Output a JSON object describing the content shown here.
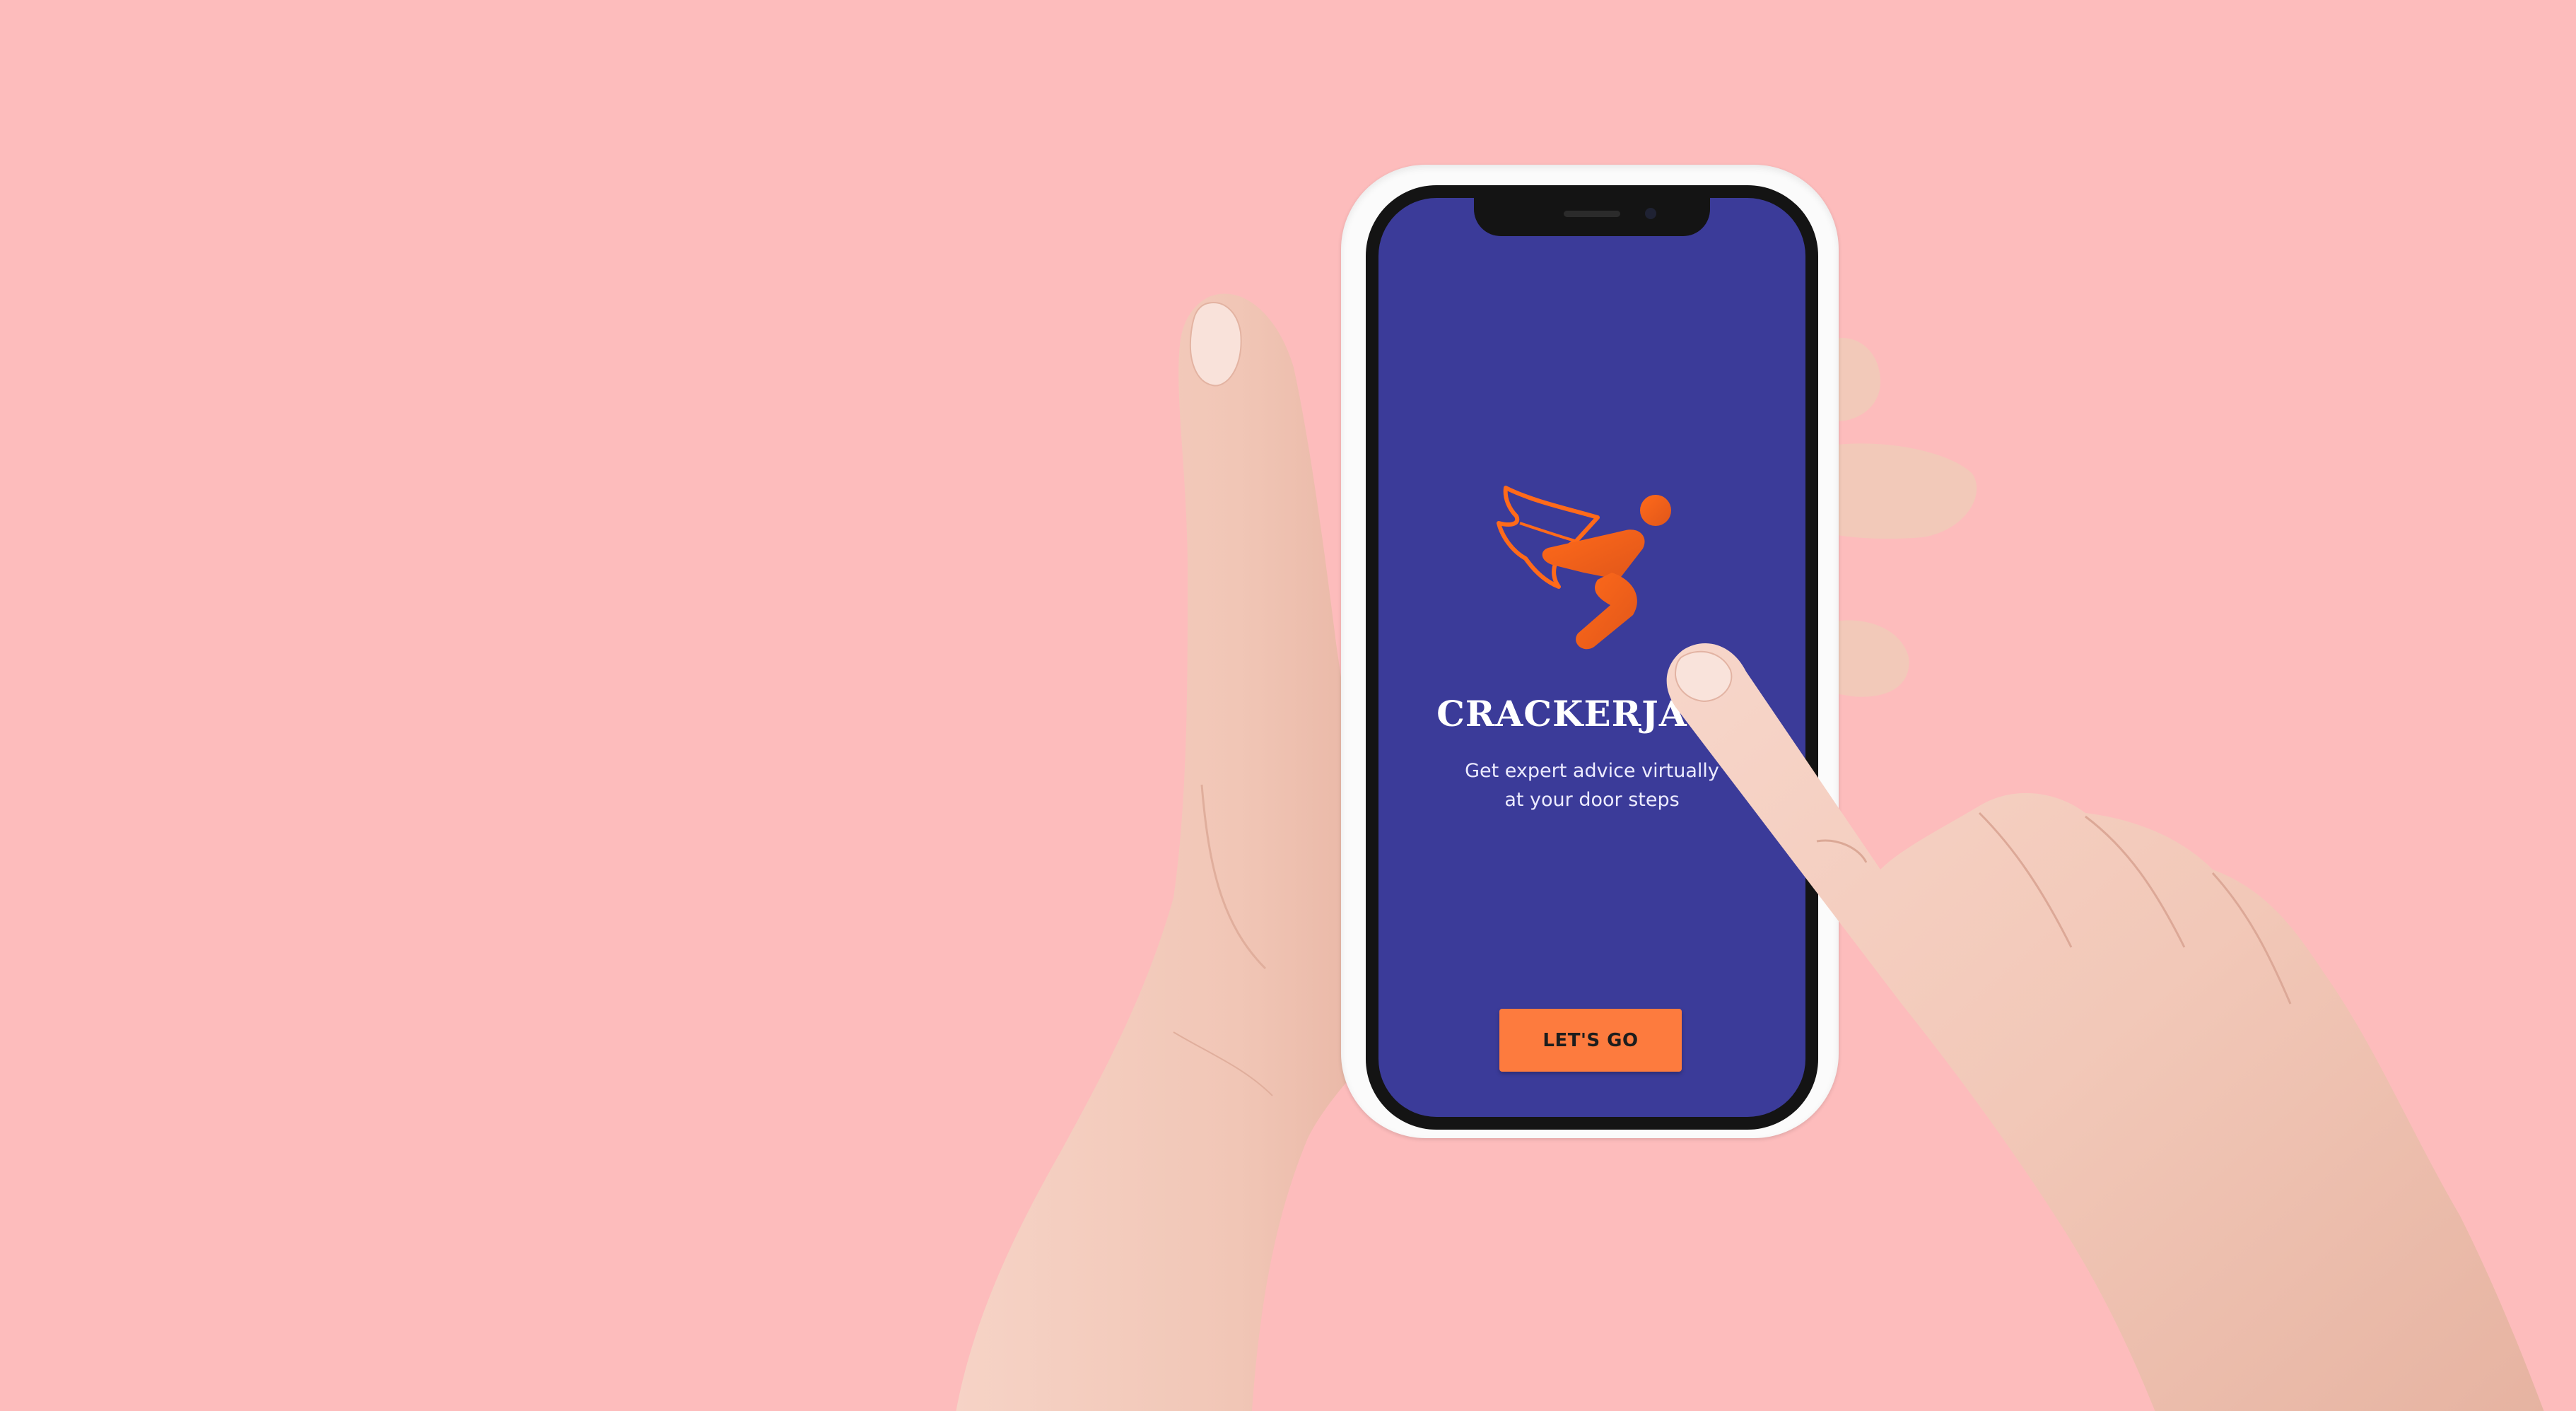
{
  "colors": {
    "background": "#fdbcbc",
    "screen": "#3b3b99",
    "accent": "#fd7b3e",
    "skin": "#f3cbbd"
  },
  "app": {
    "logo_icon": "flying-superhero-logo-icon",
    "name": "CRACKERJACK",
    "tagline_line1": "Get expert advice virtually",
    "tagline_line2": "at your door steps",
    "cta_label": "LET'S GO"
  }
}
